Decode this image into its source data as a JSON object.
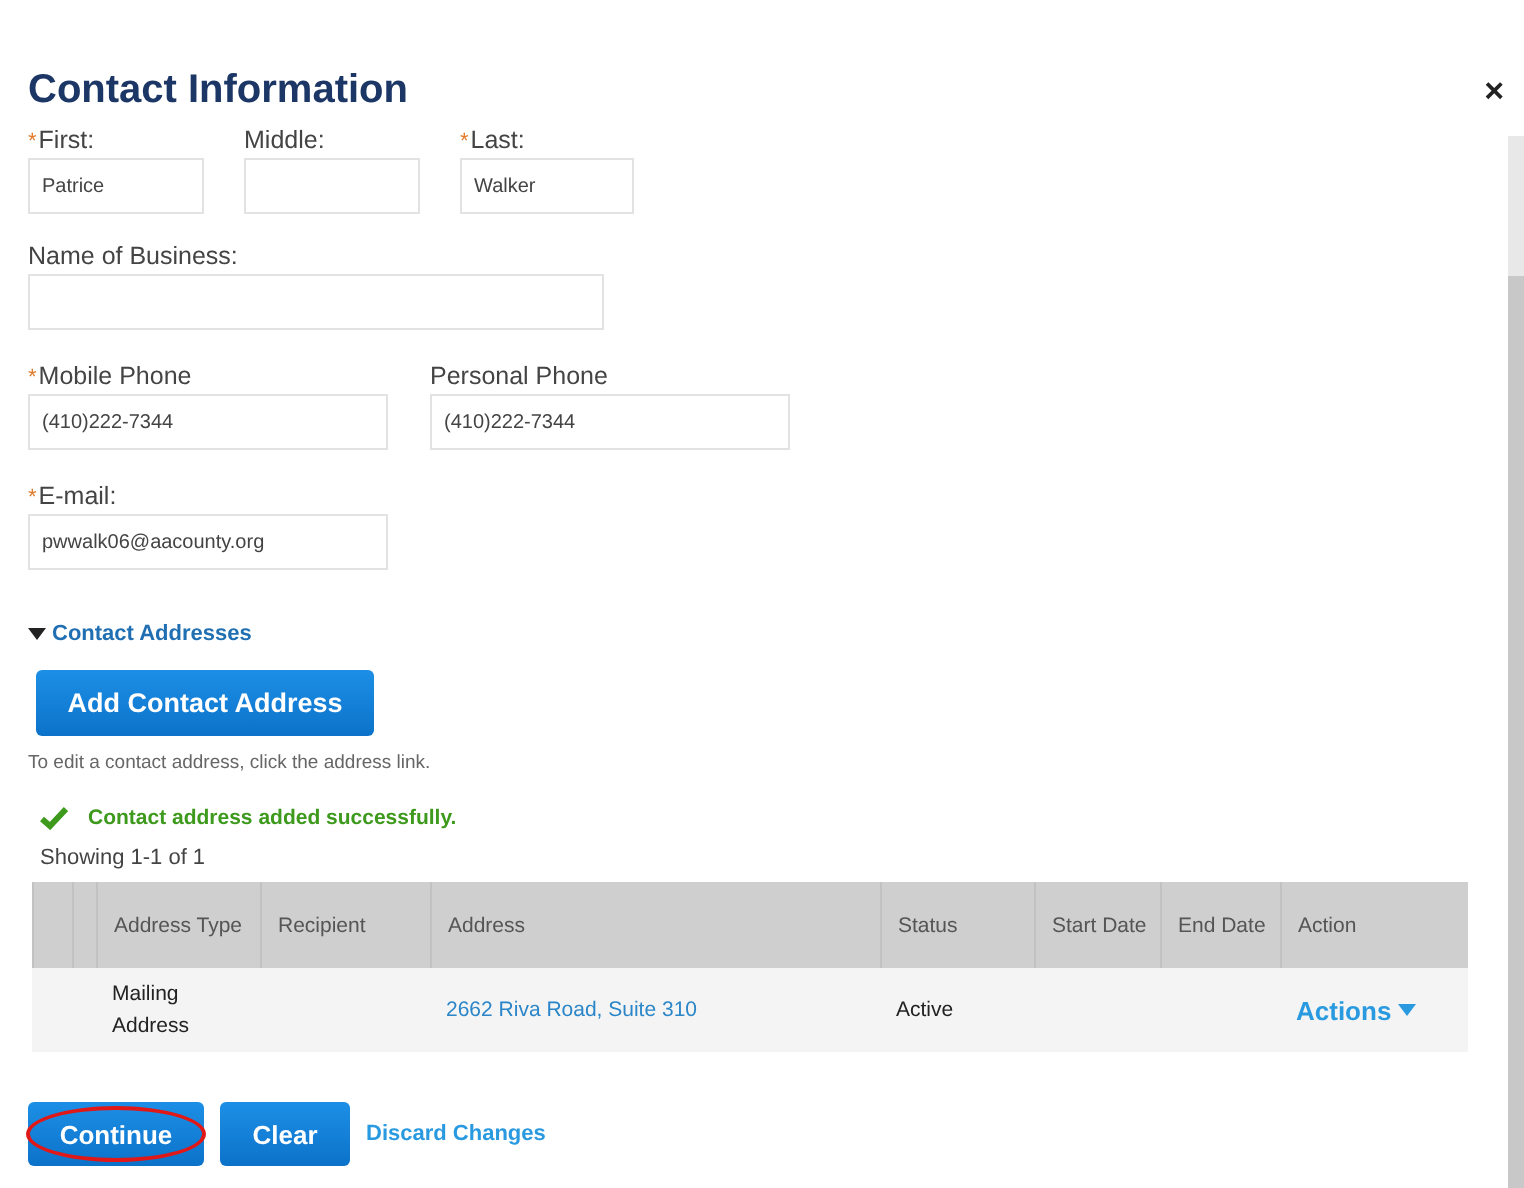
{
  "dialog": {
    "title": "Contact Information",
    "close": "×"
  },
  "name_fields": [
    {
      "label": "First:",
      "required_mark": "*",
      "value": "Patrice"
    },
    {
      "label": "Middle:"
    },
    {
      "label": "Last:",
      "required_mark": "*",
      "value": "Walker"
    }
  ],
  "business_field": {
    "label": "Name of Business:"
  },
  "phone_fields": [
    {
      "label": "Mobile Phone",
      "required_mark": "*",
      "value": "(410)222-7344"
    },
    {
      "label": "Personal Phone",
      "value": "(410)222-7344"
    }
  ],
  "email_field": {
    "label": "E-mail:",
    "required_mark": "*",
    "value": "pwwalk06@aacounty.org"
  },
  "addresses_section": {
    "title": "Contact Addresses",
    "expanded": true,
    "add_button": "Add Contact Address",
    "hint": "To edit a contact address, click the address link.",
    "success_message": "Contact address added successfully.",
    "showing": "Showing 1-1 of 1"
  },
  "table": {
    "columns": [
      null,
      null,
      "Address Type",
      "Recipient",
      "Address",
      "Status",
      "Start Date",
      "End Date",
      "Action"
    ],
    "rows": [
      {
        "address_type": "Mailing Address",
        "address": "2662 Riva Road, Suite 310",
        "status": "Active",
        "action": "Actions"
      }
    ]
  },
  "buttons": [
    {
      "label": "Continue",
      "kind": "primary",
      "highlighted": true
    },
    {
      "label": "Clear",
      "kind": "primary",
      "highlighted": false
    },
    {
      "label": "Discard Changes",
      "kind": "link"
    }
  ]
}
